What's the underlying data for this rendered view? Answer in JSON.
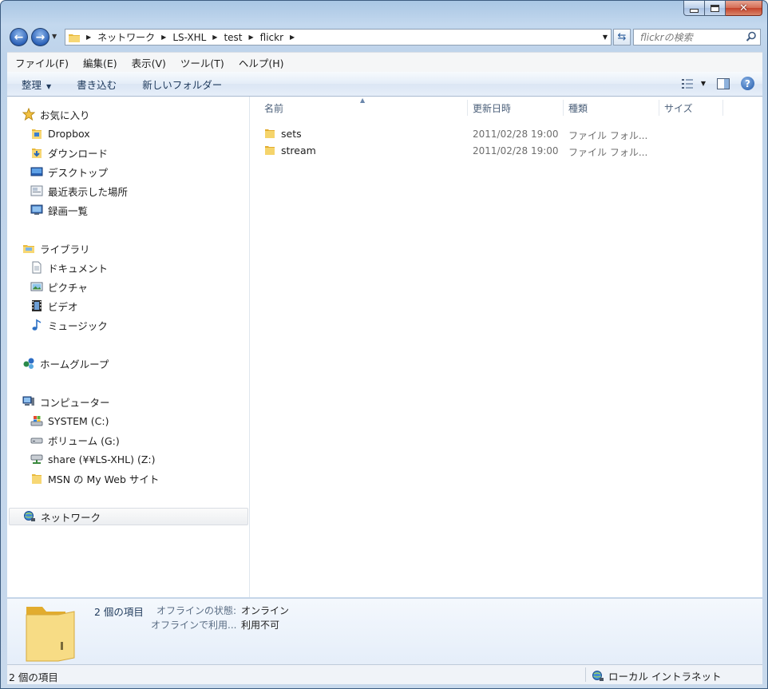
{
  "window": {
    "caption": {
      "minimize_icon": "minimize-icon",
      "maximize_icon": "maximize-icon",
      "close_icon": "close-icon"
    }
  },
  "nav": {
    "breadcrumbs": [
      "ネットワーク",
      "LS-XHL",
      "test",
      "flickr"
    ],
    "search_placeholder": "flickrの検索"
  },
  "menu": [
    "ファイル(F)",
    "編集(E)",
    "表示(V)",
    "ツール(T)",
    "ヘルプ(H)"
  ],
  "commands": {
    "organize": "整理",
    "burn": "書き込む",
    "new_folder": "新しいフォルダー"
  },
  "sidebar": {
    "favorites": {
      "header": "お気に入り",
      "items": [
        "Dropbox",
        "ダウンロード",
        "デスクトップ",
        "最近表示した場所",
        "録画一覧"
      ]
    },
    "libraries": {
      "header": "ライブラリ",
      "items": [
        "ドキュメント",
        "ピクチャ",
        "ビデオ",
        "ミュージック"
      ]
    },
    "homegroup": "ホームグループ",
    "computer": {
      "header": "コンピューター",
      "items": [
        "SYSTEM (C:)",
        "ボリューム (G:)",
        "share (¥¥LS-XHL) (Z:)",
        "MSN の My Web サイト"
      ]
    },
    "network": "ネットワーク"
  },
  "columns": {
    "name": "名前",
    "modified": "更新日時",
    "type": "種類",
    "size": "サイズ"
  },
  "files": [
    {
      "name": "sets",
      "modified": "2011/02/28 19:00",
      "type": "ファイル フォル..."
    },
    {
      "name": "stream",
      "modified": "2011/02/28 19:00",
      "type": "ファイル フォル..."
    }
  ],
  "details": {
    "count": "2 個の項目",
    "offline_status_label": "オフラインの状態:",
    "offline_status_value": "オンライン",
    "offline_use_label": "オフラインで利用...",
    "offline_use_value": "利用不可"
  },
  "status": {
    "count": "2 個の項目",
    "zone": "ローカル イントラネット"
  },
  "colors": {
    "accent": "#1e395b",
    "folder": "#f0c85a",
    "selection": "#eceef1"
  }
}
